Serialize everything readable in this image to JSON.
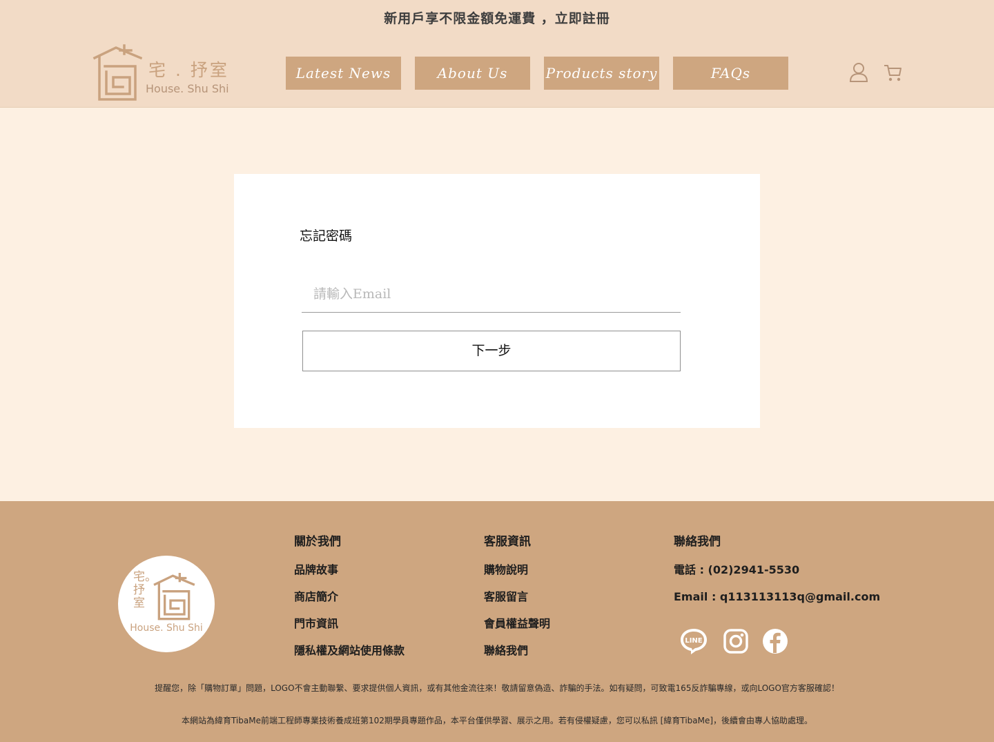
{
  "announcement": "新用戶享不限金額免運費 ，立即註冊",
  "logo": {
    "cn": "宅 . 抒室",
    "en": "House. Shu Shi"
  },
  "nav": [
    {
      "label": "Latest News"
    },
    {
      "label": "About Us"
    },
    {
      "label": "Products story"
    },
    {
      "label": "FAQs"
    }
  ],
  "header_icons": [
    "user-icon",
    "cart-icon"
  ],
  "form": {
    "title": "忘記密碼",
    "email_placeholder": "請輸入Email",
    "email_value": "",
    "next_label": "下一步"
  },
  "footer": {
    "logo": {
      "cn": "宅。抒室",
      "en": "House. Shu Shi"
    },
    "about": {
      "heading": "關於我們",
      "items": [
        "品牌故事",
        "商店簡介",
        "門市資訊",
        "隱私權及網站使用條款"
      ]
    },
    "service": {
      "heading": "客服資訊",
      "items": [
        "購物說明",
        "客服留言",
        "會員權益聲明",
        "聯絡我們"
      ]
    },
    "contact": {
      "heading": "聯絡我們",
      "phone": "電話 : (02)2941-5530",
      "email": "Email : q113113113q@gmail.com",
      "social": [
        "line-icon",
        "instagram-icon",
        "facebook-icon"
      ]
    },
    "notice1": "提醒您，除「購物訂單」問題，LOGO不會主動聯繫、要求提供個人資訊，或有其他金流往來！敬請留意偽造、詐騙的手法。如有疑問，可致電165反詐騙專線，或向LOGO官方客服確認！",
    "notice2": "本網站為緯育TibaMe前端工程師專業技術養成班第102期學員專題作品，本平台僅供學習、展示之用。若有侵權疑慮，您可以私訊 [緯育TibaMe]，後續會由專人協助處理。"
  },
  "colors": {
    "header_bg": "#f2dbc6",
    "page_bg": "#fdf0e2",
    "accent": "#cea680",
    "logo": "#c9a27f"
  }
}
